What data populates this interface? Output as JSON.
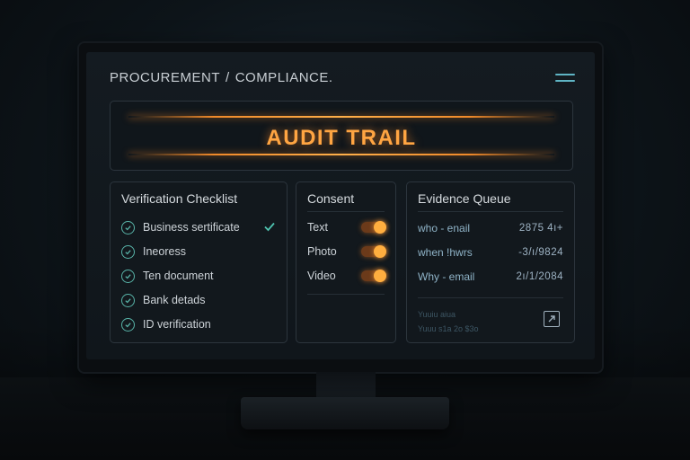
{
  "header": {
    "breadcrumb": [
      "PROCUREMENT",
      "COMPLIANCE."
    ],
    "separator": "/",
    "menu_icon": "hamburger-icon"
  },
  "banner": {
    "title": "AUDIT TRAIL",
    "accent_color": "#ffa542"
  },
  "checklist": {
    "title": "Verification Checklist",
    "items": [
      {
        "label": "Business sertificate",
        "done": true
      },
      {
        "label": "Ineoress",
        "done": false
      },
      {
        "label": "Ten document",
        "done": false
      },
      {
        "label": "Bank detads",
        "done": false
      },
      {
        "label": "ID verification",
        "done": false
      }
    ],
    "icon": "check-circle-icon"
  },
  "consent": {
    "title": "Consent",
    "items": [
      {
        "label": "Text",
        "on": true
      },
      {
        "label": "Photo",
        "on": true
      },
      {
        "label": "Video",
        "on": true
      }
    ],
    "toggle_color": "#ffae3f"
  },
  "evidence": {
    "title": "Evidence Queue",
    "rows": [
      {
        "label": "who - enail",
        "value": "2875 4ı+"
      },
      {
        "label": "when  !hwrs",
        "value": "-3/ı/9824"
      },
      {
        "label": "Why - email",
        "value": "2ı/1/2084"
      }
    ],
    "footer_lines": [
      "Yuuiu   aiua",
      "Yuuu s1a 2o  $3o"
    ],
    "open_icon": "external-link-icon"
  }
}
